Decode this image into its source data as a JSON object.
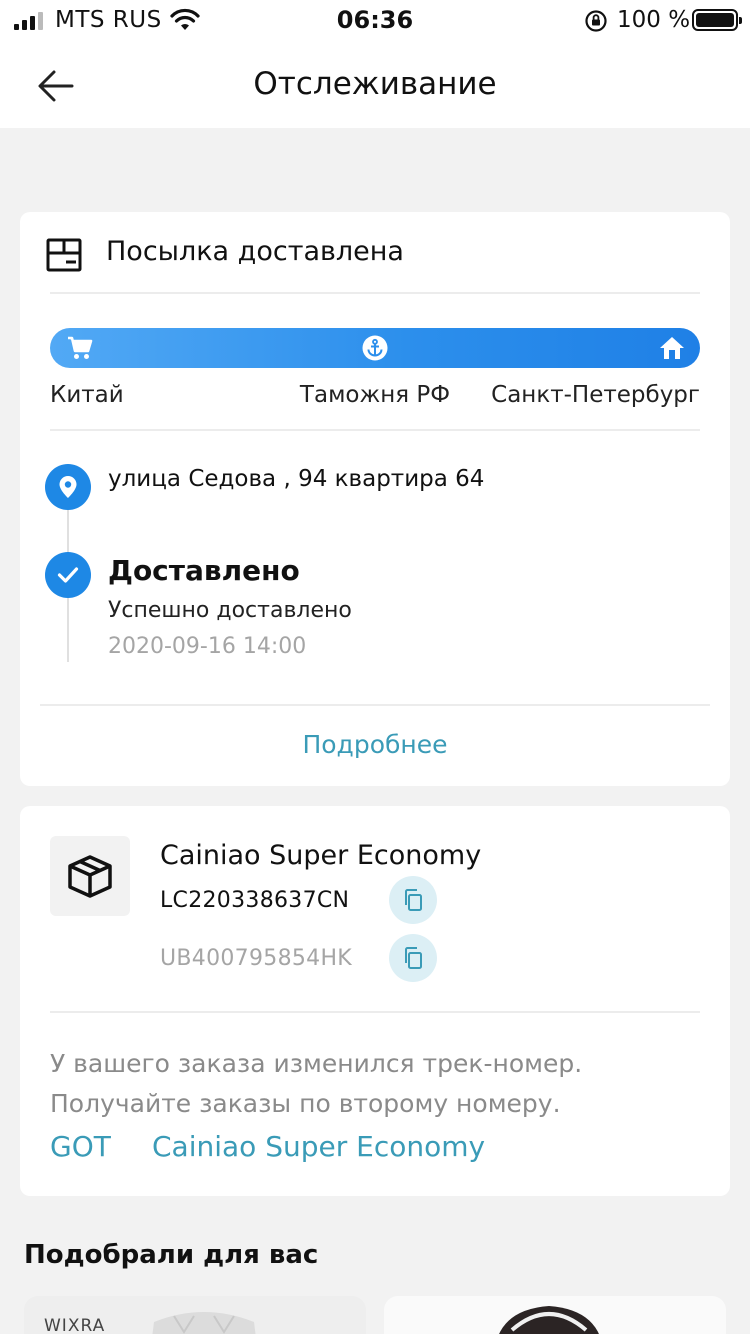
{
  "status_bar": {
    "carrier": "MTS RUS",
    "time": "06:36",
    "battery": "100 %"
  },
  "header": {
    "title": "Отслеживание"
  },
  "tracking": {
    "status_title": "Посылка доставлена",
    "stages": [
      "Китай",
      "Таможня РФ",
      "Санкт-Петербург"
    ],
    "address": "улица Седова , 94 квартира 64",
    "event": {
      "title": "Доставлено",
      "description": "Успешно доставлено",
      "time": "2020-09-16 14:00"
    },
    "more_label": "Подробнее",
    "accent_color": "#1e88e5"
  },
  "carrier": {
    "name": "Cainiao Super Economy",
    "tracking_numbers": [
      "LC220338637CN",
      "UB400795854HK"
    ],
    "notice": "У вашего заказа изменился трек-номер. Получайте заказы по второму номеру.",
    "links": [
      "GOT",
      "Cainiao Super Economy"
    ],
    "link_color": "#3a9bb7"
  },
  "recommendations": {
    "heading": "Подобрали для вас",
    "items": [
      {
        "brand": "WIXRA"
      },
      {
        "brand": ""
      }
    ]
  }
}
